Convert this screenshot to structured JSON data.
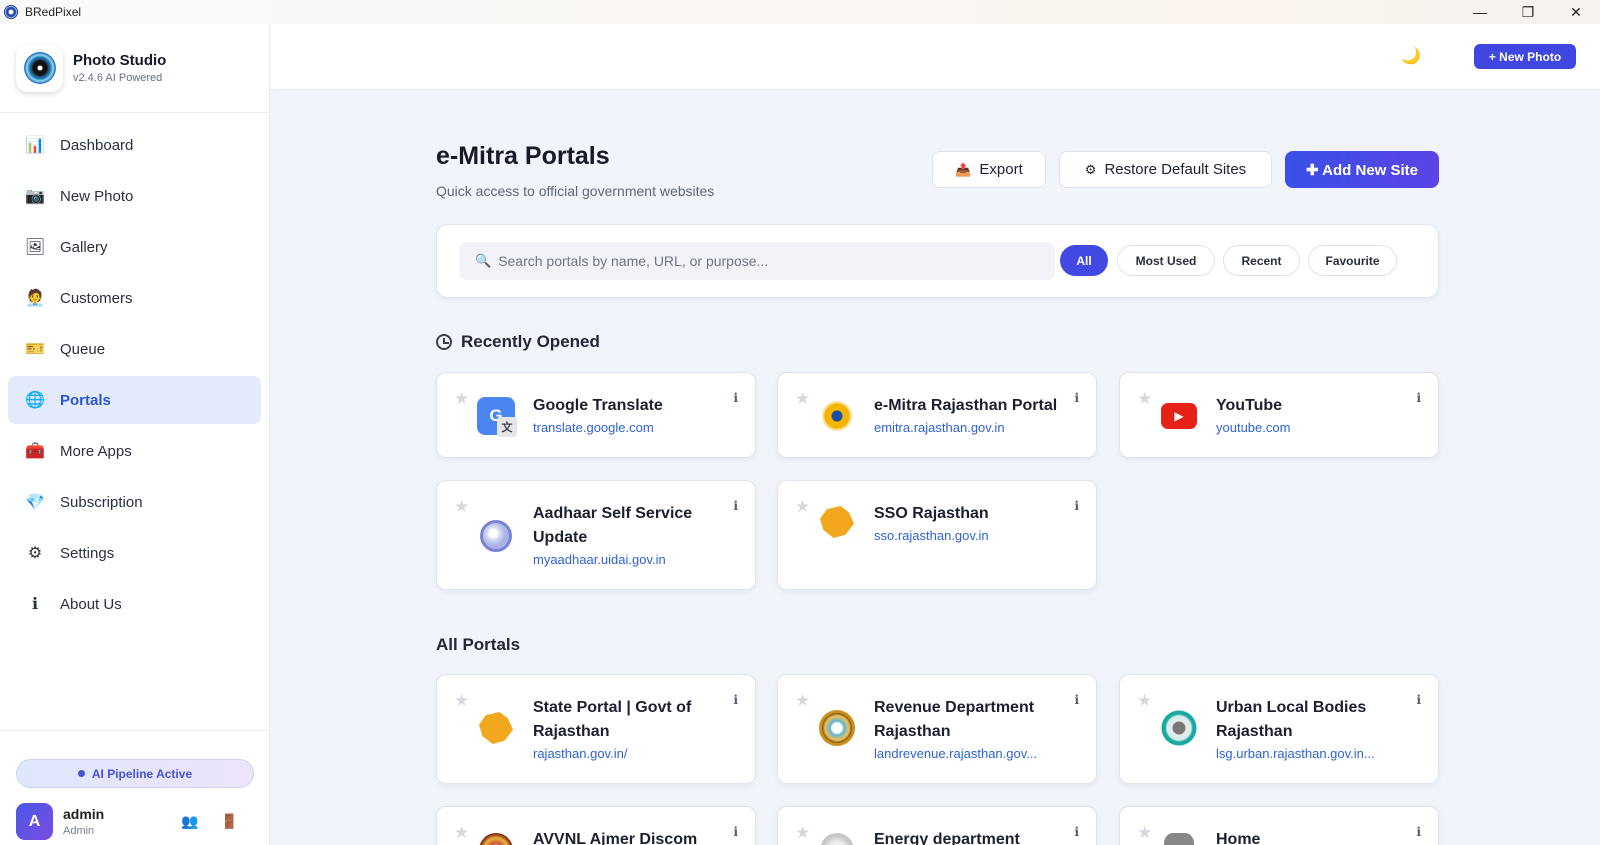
{
  "window": {
    "title": "BRedPixel",
    "controls": [
      "—",
      "❐",
      "✕"
    ]
  },
  "brand": {
    "name": "Photo Studio",
    "version": "v2.4.6 AI Powered"
  },
  "nav": [
    {
      "label": "Dashboard",
      "icon": "📊",
      "active": false
    },
    {
      "label": "New Photo",
      "icon": "📷",
      "active": false
    },
    {
      "label": "Gallery",
      "icon": "🖼",
      "active": false
    },
    {
      "label": "Customers",
      "icon": "🧑‍💼",
      "active": false
    },
    {
      "label": "Queue",
      "icon": "🎫",
      "active": false
    },
    {
      "label": "Portals",
      "icon": "🌐",
      "active": true
    },
    {
      "label": "More Apps",
      "icon": "🧰",
      "active": false
    },
    {
      "label": "Subscription",
      "icon": "💎",
      "active": false
    },
    {
      "label": "Settings",
      "icon": "⚙",
      "active": false
    },
    {
      "label": "About Us",
      "icon": "ℹ",
      "active": false
    }
  ],
  "sidebar_footer": {
    "ai_status": "AI Pipeline Active",
    "user": {
      "initial": "A",
      "name": "admin",
      "role": "Admin"
    }
  },
  "topbar": {
    "theme_icon": "🌙",
    "new_photo_label": "+ New Photo"
  },
  "page": {
    "title": "e-Mitra Portals",
    "subtitle": "Quick access to official government websites",
    "export_label": "Export",
    "restore_label": "Restore Default Sites",
    "add_label": "✚ Add New Site"
  },
  "search": {
    "placeholder": "Search portals by name, URL, or purpose...",
    "filters": [
      "All",
      "Most Used",
      "Recent",
      "Favourite"
    ],
    "active_filter": "All"
  },
  "sections": {
    "recent": "Recently Opened",
    "all": "All Portals"
  },
  "recent_portals": [
    {
      "title": "Google Translate",
      "url": "translate.google.com",
      "logo": "google-translate"
    },
    {
      "title": "e-Mitra Rajasthan Portal",
      "url": "emitra.rajasthan.gov.in",
      "logo": "emitra"
    },
    {
      "title": "YouTube",
      "url": "youtube.com",
      "logo": "youtube"
    },
    {
      "title": "Aadhaar Self Service Update",
      "url": "myaadhaar.uidai.gov.in",
      "logo": "globe"
    },
    {
      "title": "SSO Rajasthan",
      "url": "sso.rajasthan.gov.in",
      "logo": "rajasthan-map"
    }
  ],
  "all_portals": [
    {
      "title": "State Portal | Govt of Rajasthan",
      "url": "rajasthan.gov.in/",
      "logo": "rajasthan-map"
    },
    {
      "title": "Revenue Department Rajasthan",
      "url": "landrevenue.rajasthan.gov...",
      "logo": "revenue-seal"
    },
    {
      "title": "Urban Local Bodies Rajasthan",
      "url": "lsg.urban.rajasthan.gov.in...",
      "logo": "ulb-emblem"
    },
    {
      "title": "AVVNL Ajmer Discom",
      "url": "",
      "logo": "avvnl-seal"
    },
    {
      "title": "Energy department",
      "url": "",
      "logo": "energy"
    },
    {
      "title": "Home",
      "url": "",
      "logo": "home-emblem"
    }
  ],
  "card_icons": {
    "star": "★",
    "info": "i"
  },
  "colors": {
    "accent": "#4248e2",
    "link": "#2f63d2",
    "active_nav_bg": "#e2eafc"
  }
}
